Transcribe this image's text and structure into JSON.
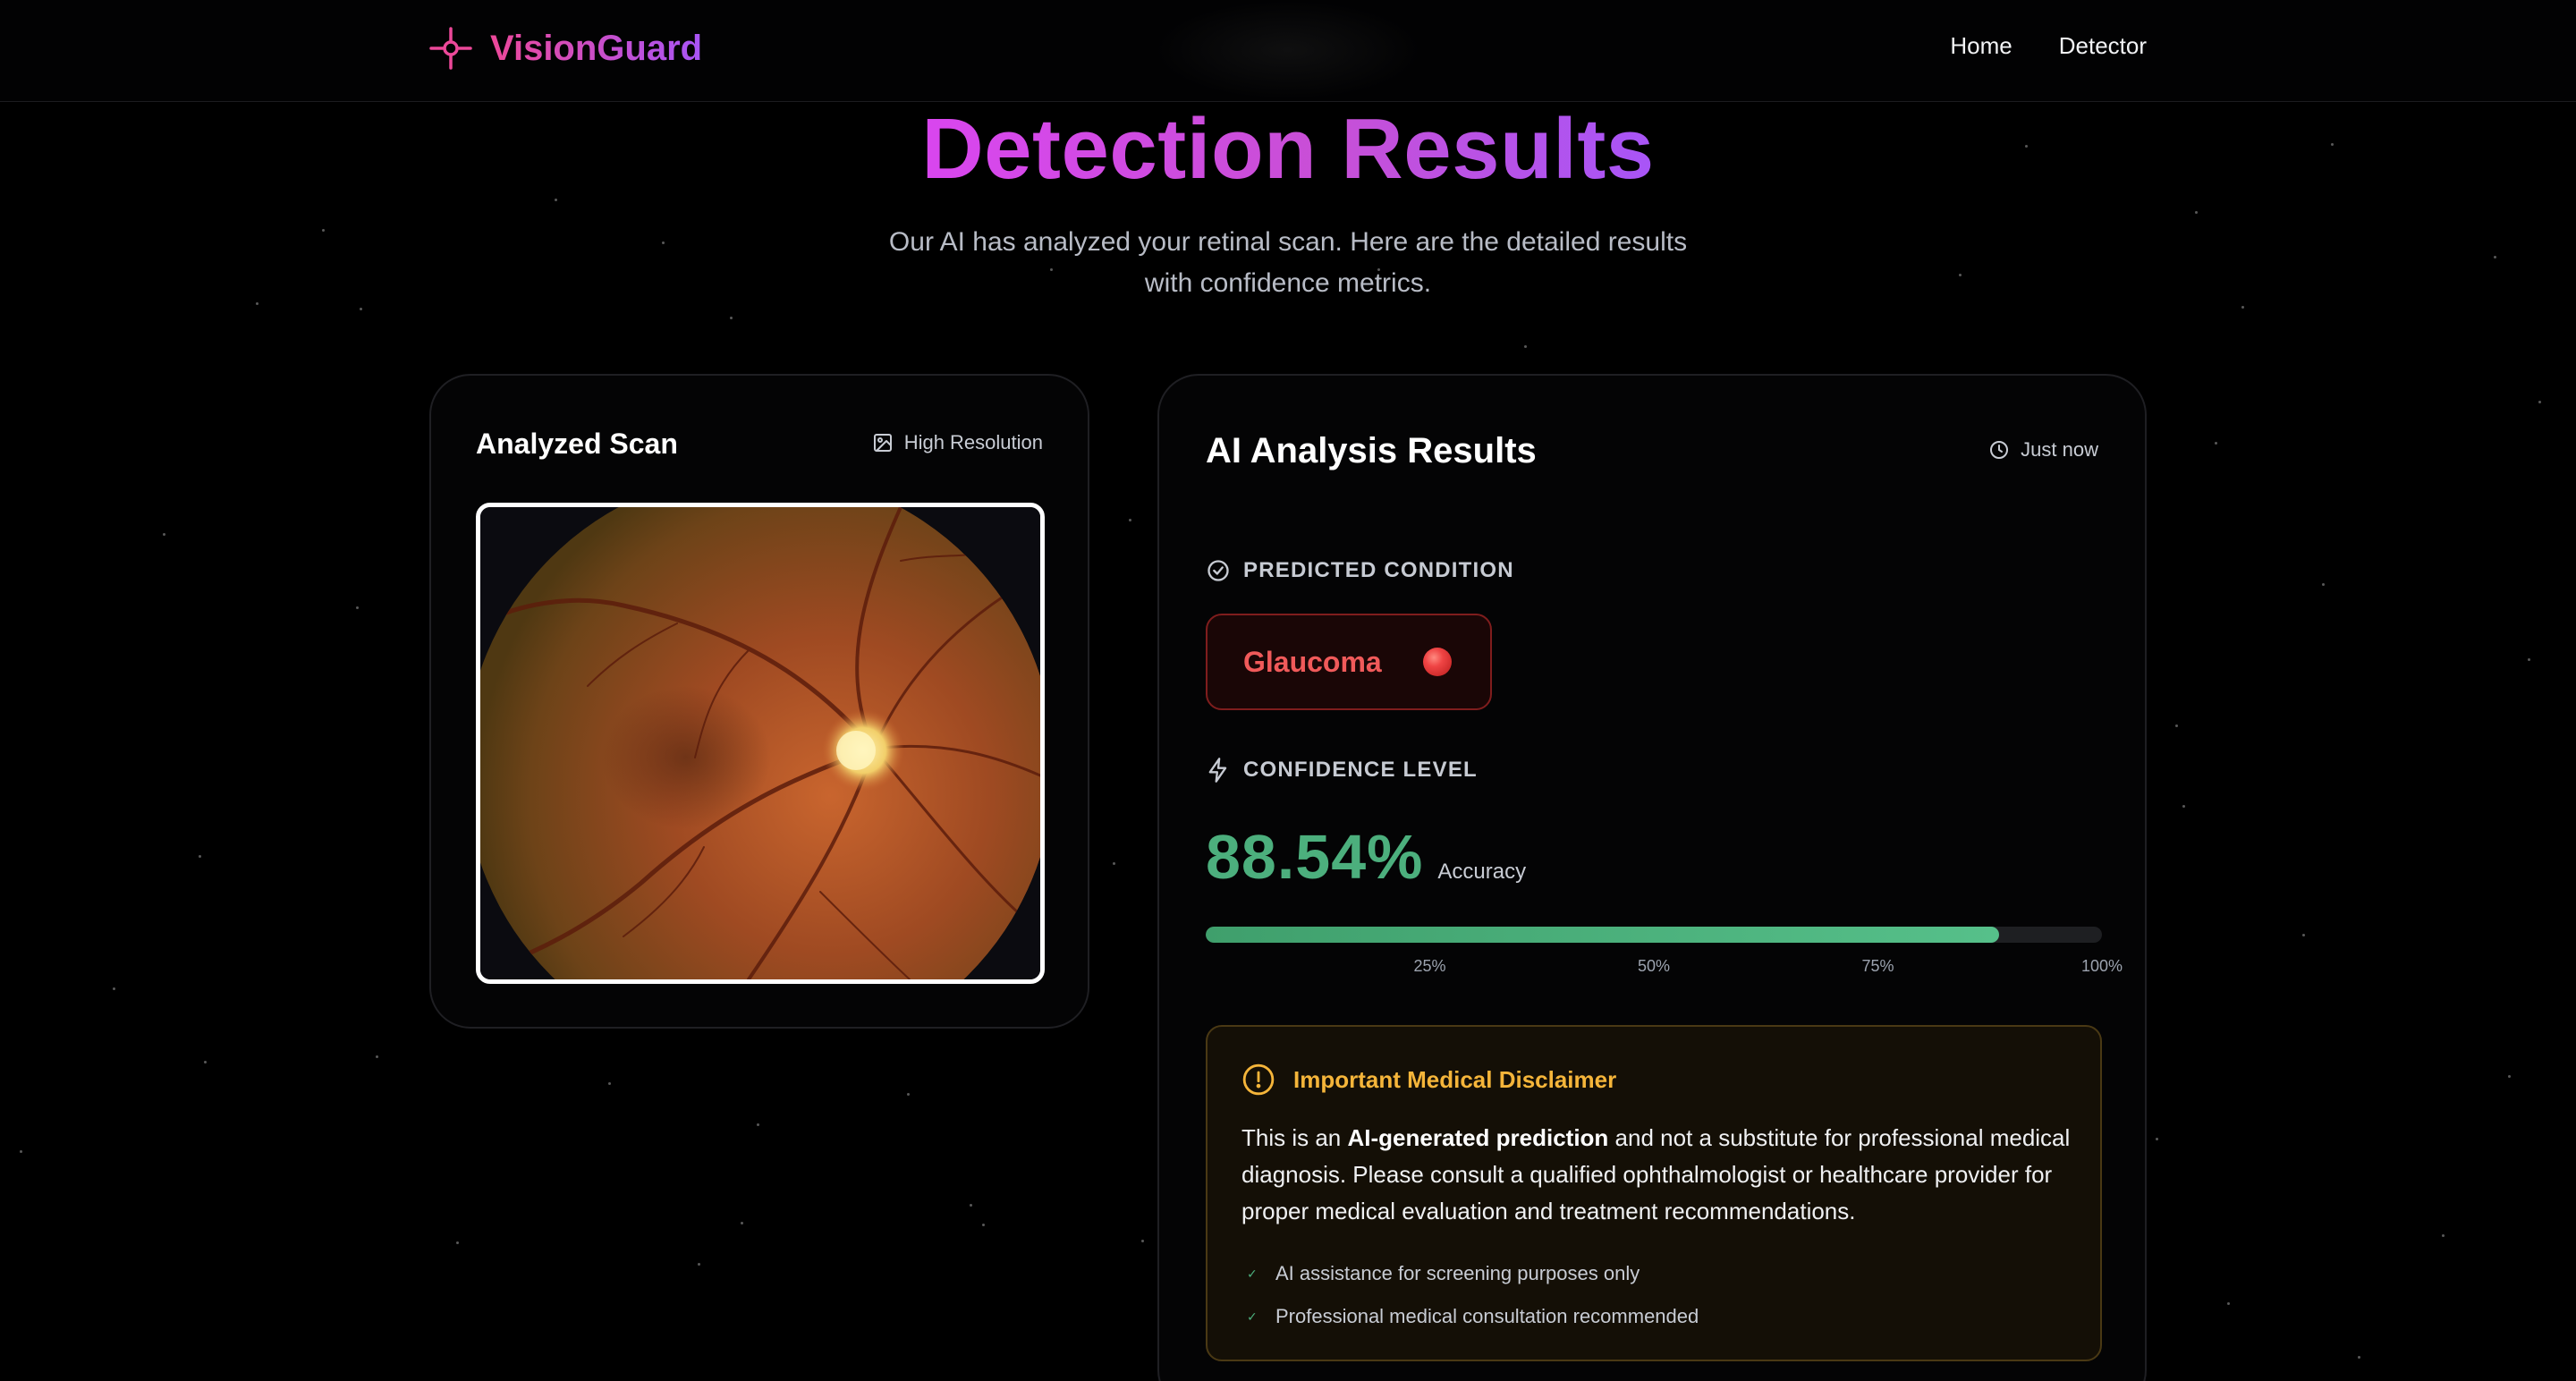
{
  "nav": {
    "brand": "VisionGuard",
    "links": [
      {
        "label": "Home"
      },
      {
        "label": "Detector"
      }
    ]
  },
  "hero": {
    "title": "Detection Results",
    "subtitle_line1": "Our AI has analyzed your retinal scan. Here are the detailed results",
    "subtitle_line2": "with confidence metrics."
  },
  "scan": {
    "title": "Analyzed Scan",
    "badge": "High Resolution"
  },
  "results": {
    "title": "AI Analysis Results",
    "timestamp": "Just now",
    "predicted_label": "PREDICTED CONDITION",
    "condition": "Glaucoma",
    "confidence_label": "CONFIDENCE LEVEL",
    "confidence_value": "88.54%",
    "confidence_caption": "Accuracy",
    "confidence_fraction": 0.8854,
    "ticks": [
      "25%",
      "50%",
      "75%",
      "100%"
    ]
  },
  "disclaimer": {
    "title": "Important Medical Disclaimer",
    "text_prefix": "This is an ",
    "text_bold": "AI-generated prediction",
    "text_suffix": " and not a substitute for professional medical diagnosis. Please consult a qualified ophthalmologist or healthcare provider for proper medical evaluation and treatment recommendations.",
    "items": [
      "AI assistance for screening purposes only",
      "Professional medical consultation recommended"
    ]
  },
  "colors": {
    "brand_gradient": [
      "#ec4899",
      "#a855f7"
    ],
    "condition": "#f05a5a",
    "confidence": "#4caf7d",
    "warning": "#f5b53a"
  },
  "icons": [
    "crosshair-logo-icon",
    "image-icon",
    "clock-icon",
    "check-circle-icon",
    "lightning-icon",
    "alert-circle-icon",
    "check-icon"
  ]
}
